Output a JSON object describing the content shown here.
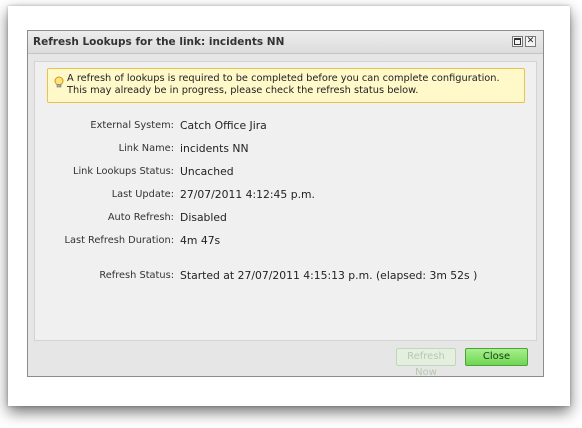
{
  "dialog": {
    "title": "Refresh Lookups for the link: incidents NN"
  },
  "notice": {
    "icon": "lightbulb-icon",
    "text": "A refresh of lookups is required to be completed before you can complete configuration. This may already be in progress, please check the refresh status below."
  },
  "fields": [
    {
      "label": "External System:",
      "value": "Catch Office Jira"
    },
    {
      "label": "Link Name:",
      "value": "incidents NN"
    },
    {
      "label": "Link Lookups Status:",
      "value": "Uncached"
    },
    {
      "label": "Last Update:",
      "value": "27/07/2011 4:12:45 p.m."
    },
    {
      "label": "Auto Refresh:",
      "value": "Disabled"
    },
    {
      "label": "Last Refresh Duration:",
      "value": "4m 47s"
    }
  ],
  "refresh_status": {
    "label": "Refresh Status:",
    "value": "Started at 27/07/2011 4:15:13 p.m. (elapsed: 3m 52s )"
  },
  "buttons": {
    "refresh_now": "Refresh Now",
    "close": "Close"
  }
}
